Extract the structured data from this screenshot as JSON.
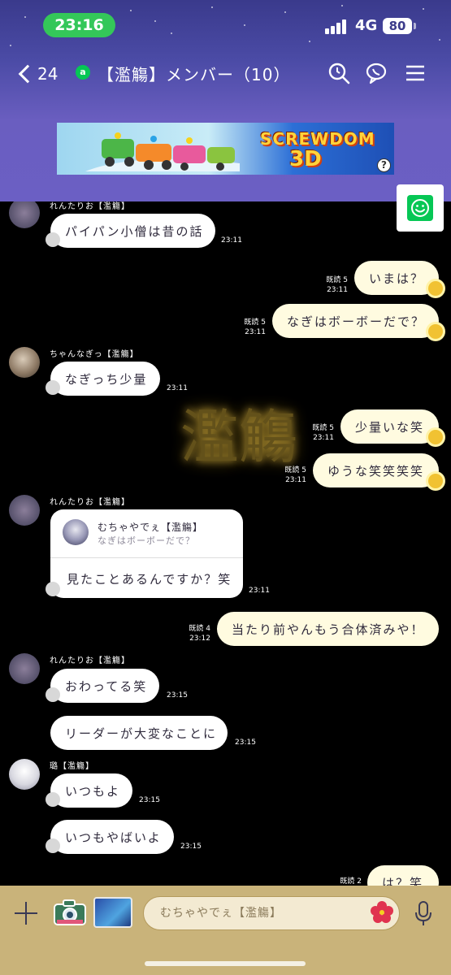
{
  "status_bar": {
    "time": "23:16",
    "network": "4G",
    "battery": "80"
  },
  "nav": {
    "back_count": "24",
    "group_badge": "a",
    "title": "【濫觴】メンバー（10）"
  },
  "ad": {
    "title_line1": "SCREWDOM",
    "title_line2": "3D",
    "help": "?"
  },
  "watermark": "濫觴",
  "messages": [
    {
      "sender": "れんたりお【濫觴】",
      "text": "パイパン小僧は昔の話",
      "time": "23:11",
      "dir": "in"
    },
    {
      "text": "いまは？",
      "read": "既読 5",
      "time": "23:11",
      "dir": "out"
    },
    {
      "text": "なぎはボーボーだで？",
      "read": "既読 5",
      "time": "23:11",
      "dir": "out"
    },
    {
      "sender": "ちゃんなぎっ【濫觴】",
      "text": "なぎっち少量",
      "time": "23:11",
      "dir": "in"
    },
    {
      "text": "少量いな笑",
      "read": "既読 5",
      "time": "23:11",
      "dir": "out"
    },
    {
      "text": "ゆうな笑笑笑笑",
      "read": "既読 5",
      "time": "23:11",
      "dir": "out"
    },
    {
      "sender": "れんたりお【濫觴】",
      "reply_name": "むちゃやでぇ【濫觴】",
      "reply_snippet": "なぎはボーボーだで？",
      "text": "見たことあるんですか？笑",
      "time": "23:11",
      "dir": "in"
    },
    {
      "text": "当たり前やんもう合体済みや！",
      "read": "既読 4",
      "time": "23:12",
      "dir": "out"
    },
    {
      "sender": "れんたりお【濫觴】",
      "text": "おわってる笑",
      "time": "23:15",
      "dir": "in"
    },
    {
      "text": "リーダーが大変なことに",
      "time": "23:15",
      "dir": "in"
    },
    {
      "sender": "璐【濫觴】",
      "text": "いつもよ",
      "time": "23:15",
      "dir": "in"
    },
    {
      "text": "いつもやばいよ",
      "time": "23:15",
      "dir": "in"
    },
    {
      "text": "は？笑",
      "read": "既読 2",
      "dir": "out"
    }
  ],
  "footer": {
    "input_placeholder": "むちゃやでぇ【濫觴】"
  },
  "colors": {
    "header_top": "#3a3a8c",
    "header_bottom": "#6b5fc4",
    "time_pill": "#34c759",
    "line_green": "#06c755",
    "footer": "#c9b37a",
    "bubble_out": "#fffbe0"
  }
}
